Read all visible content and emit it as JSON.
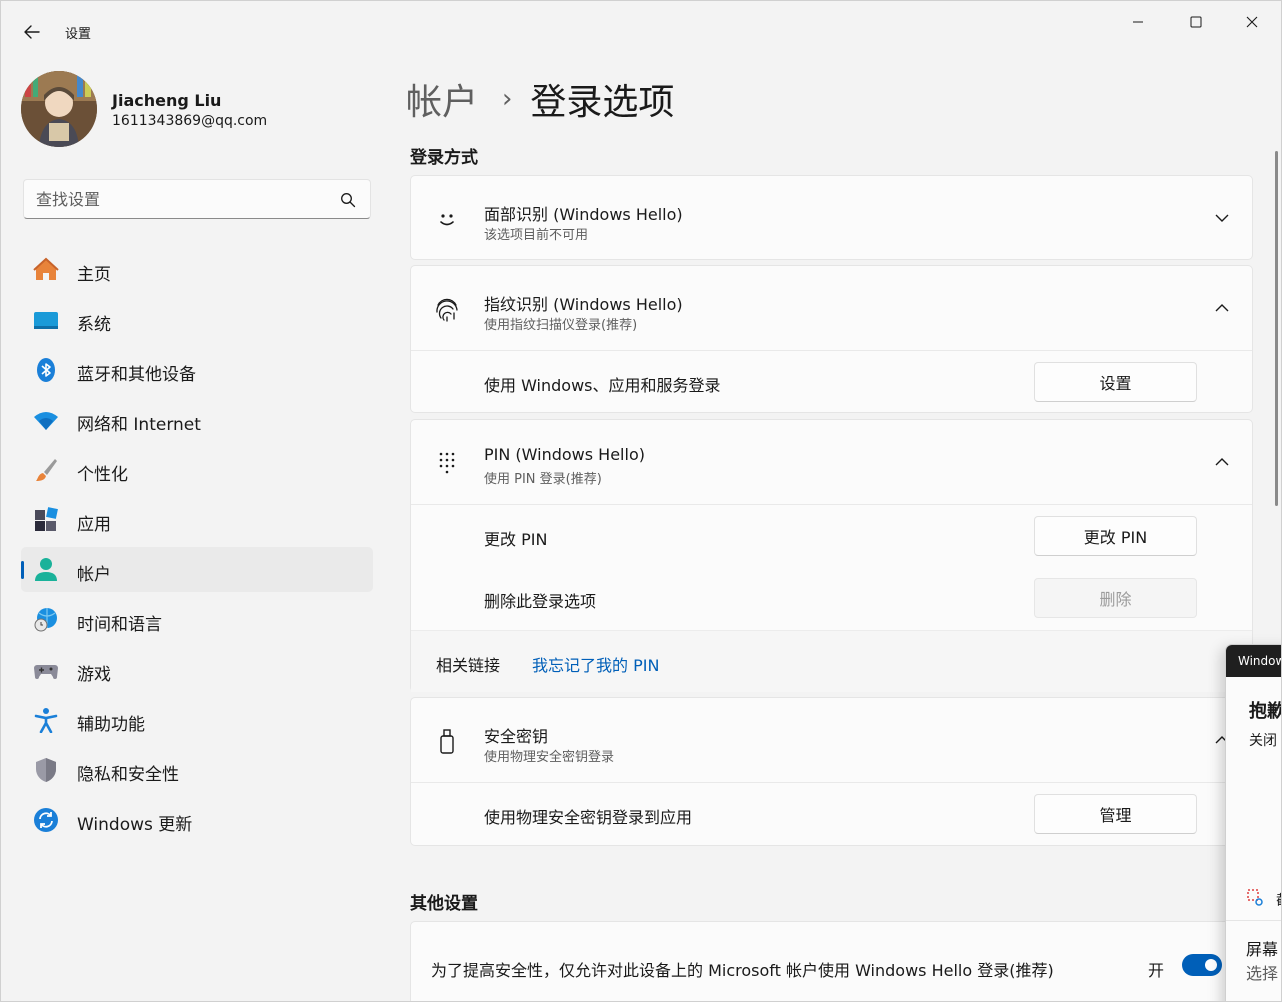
{
  "window": {
    "title": "设置",
    "controls": {
      "minimize": "minimize-icon",
      "maximize": "maximize-icon",
      "close": "close-icon"
    }
  },
  "profile": {
    "name": "Jiacheng Liu",
    "email": "1611343869@qq.com"
  },
  "search": {
    "placeholder": "查找设置"
  },
  "sidebar": {
    "items": [
      {
        "label": "主页",
        "icon": "home-icon"
      },
      {
        "label": "系统",
        "icon": "system-icon"
      },
      {
        "label": "蓝牙和其他设备",
        "icon": "bluetooth-icon"
      },
      {
        "label": "网络和 Internet",
        "icon": "wifi-icon"
      },
      {
        "label": "个性化",
        "icon": "brush-icon"
      },
      {
        "label": "应用",
        "icon": "apps-icon"
      },
      {
        "label": "帐户",
        "icon": "account-icon",
        "active": true
      },
      {
        "label": "时间和语言",
        "icon": "globe-clock-icon"
      },
      {
        "label": "游戏",
        "icon": "gamepad-icon"
      },
      {
        "label": "辅助功能",
        "icon": "accessibility-icon"
      },
      {
        "label": "隐私和安全性",
        "icon": "shield-icon"
      },
      {
        "label": "Windows 更新",
        "icon": "update-icon"
      }
    ]
  },
  "breadcrumb": {
    "parent": "帐户",
    "separator": "›",
    "current": "登录选项"
  },
  "sections": {
    "signin_methods": "登录方式",
    "other_settings": "其他设置"
  },
  "face": {
    "title": "面部识别 (Windows Hello)",
    "subtitle": "该选项目前不可用"
  },
  "fingerprint": {
    "title": "指纹识别 (Windows Hello)",
    "subtitle": "使用指纹扫描仪登录(推荐)",
    "row_label": "使用 Windows、应用和服务登录",
    "button": "设置"
  },
  "pin": {
    "title": "PIN (Windows Hello)",
    "subtitle": "使用 PIN 登录(推荐)",
    "change_label": "更改 PIN",
    "change_button": "更改 PIN",
    "remove_label": "删除此登录选项",
    "remove_button": "删除",
    "related_label": "相关链接",
    "related_link": "我忘记了我的 PIN"
  },
  "security_key": {
    "title": "安全密钥",
    "subtitle": "使用物理安全密钥登录",
    "row_label": "使用物理安全密钥登录到应用",
    "button": "管理"
  },
  "other": {
    "toggle_label": "为了提高安全性，仅允许对此设备上的 Microsoft 帐户使用 Windows Hello 登录(推荐)",
    "toggle_state": "开",
    "toggle_on": true
  },
  "overlay": {
    "bar_title": "Window",
    "heading": "抱歉",
    "text": "关闭",
    "item": "截",
    "line2": "屏幕",
    "line3": "选择"
  },
  "colors": {
    "accent": "#005fb8",
    "background": "#f3f3f3",
    "card": "#fbfbfb"
  }
}
